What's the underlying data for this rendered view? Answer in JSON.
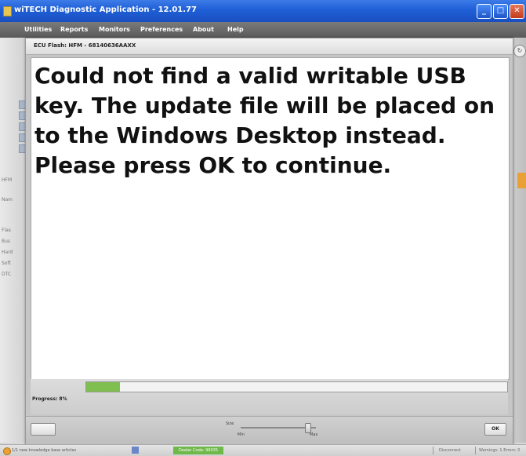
{
  "window": {
    "title": "wiTECH Diagnostic Application - 12.01.77",
    "minimize_glyph": "_",
    "maximize_glyph": "□",
    "close_glyph": "✕"
  },
  "menu": {
    "items": [
      "Utilities",
      "Reports",
      "Monitors",
      "Preferences",
      "About",
      "Help"
    ]
  },
  "background_app": {
    "side_labels": [
      "HFM",
      "Nam",
      "Flas",
      "Bus",
      "Hard",
      "Soft",
      "DTC"
    ],
    "refresh_glyph": "↻"
  },
  "dialog": {
    "title": "ECU Flash: HFM - 68140636AAXX",
    "message": "Could not find a valid writable USB key. The update file will be placed on to the Windows Desktop instead. Please press OK to continue.",
    "progress_label": "Progress: 8%",
    "progress_percent": 8,
    "size_label": "Size",
    "size_min_label": "Min",
    "size_max_label": "Max",
    "size_level": 0.9,
    "ok_label": "OK"
  },
  "statusbar": {
    "kb_link": "1/1 new knowledge base articles",
    "dealer_code": "Dealer Code: 99035",
    "disconnect": "Disconnect",
    "warnings": "Warnings: 1 Errors: 0"
  },
  "colors": {
    "titlebar_blue": "#1f5fd6",
    "progress_green": "#7fbf4f",
    "dealer_green": "#6fb84a",
    "accent_orange": "#e9a036"
  }
}
